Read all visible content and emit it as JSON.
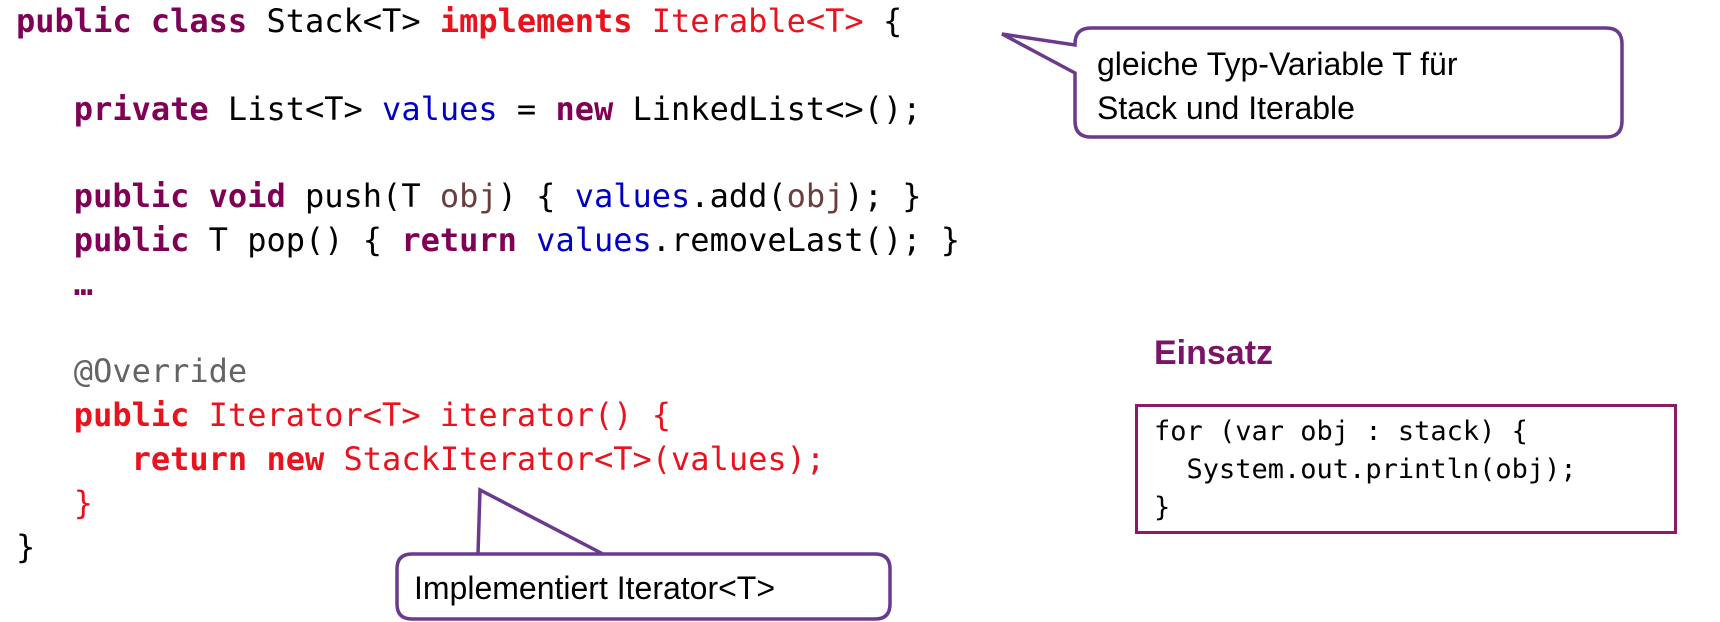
{
  "code": {
    "line1": {
      "kw1": "public",
      "kw2": "class",
      "name": "Stack<T>",
      "kw3": "implements",
      "iface": "Iterable<T>",
      "brace": "{"
    },
    "line3": {
      "kw1": "private",
      "type": "List<T>",
      "field": "values",
      "eq": "=",
      "kw2": "new",
      "ctor": "LinkedList<>();"
    },
    "line5": {
      "kw1": "public",
      "kw2": "void",
      "sig": "push(T",
      "param": "obj",
      "open": ") {",
      "field": "values",
      "call": ".add(",
      "param2": "obj",
      "close": "); }"
    },
    "line6": {
      "kw1": "public",
      "sig": "T pop() {",
      "kw2": "return",
      "field": "values",
      "call": ".removeLast(); }"
    },
    "line7": {
      "ellipsis": "…"
    },
    "line9": {
      "annotation": "@Override"
    },
    "line10": {
      "kw1": "public",
      "rest": "Iterator<T> iterator() {"
    },
    "line11": {
      "kw1": "return",
      "kw2": "new",
      "rest": "StackIterator<T>(values);"
    },
    "line12": {
      "brace": "}"
    },
    "line13": {
      "brace": "}"
    }
  },
  "callouts": {
    "top": {
      "line1": "gleiche Typ-Variable T  für",
      "line2": "Stack und Iterable"
    },
    "bottom": {
      "text": "Implementiert Iterator<T>"
    }
  },
  "usage": {
    "title": "Einsatz",
    "lines": [
      "for (var obj : stack) {",
      "  System.out.println(obj);",
      "}"
    ]
  },
  "colors": {
    "keyword": "#7f0055",
    "highlight": "#e8131c",
    "field": "#0000c0",
    "param": "#6a3e3e",
    "annotation": "#646464",
    "callout_border": "#6b3a8c",
    "box_border": "#8b1a68",
    "title": "#7b1467"
  }
}
